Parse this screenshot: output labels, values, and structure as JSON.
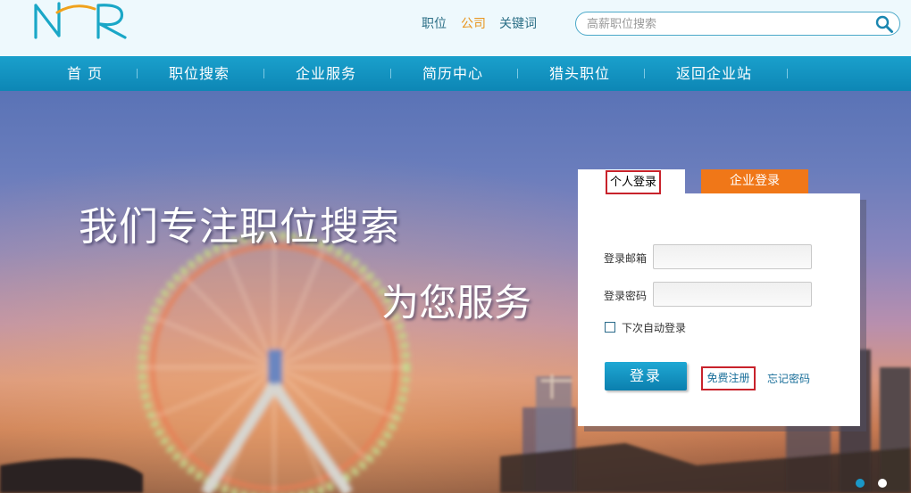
{
  "header": {
    "logo_text": "NHR",
    "search_types": [
      {
        "label": "职位",
        "active": false
      },
      {
        "label": "公司",
        "active": true
      },
      {
        "label": "关键词",
        "active": false
      }
    ],
    "search": {
      "placeholder": "高薪职位搜索",
      "value": "",
      "icon": "search-icon"
    }
  },
  "nav": {
    "items": [
      {
        "label": "首 页"
      },
      {
        "label": "职位搜索"
      },
      {
        "label": "企业服务"
      },
      {
        "label": "简历中心"
      },
      {
        "label": "猎头职位"
      },
      {
        "label": "返回企业站"
      }
    ]
  },
  "hero": {
    "slogan_line1": "我们专注职位搜索",
    "slogan_line2": "为您服务"
  },
  "login": {
    "tab_personal": "个人登录",
    "tab_company": "企业登录",
    "email_label": "登录邮箱",
    "email_value": "",
    "password_label": "登录密码",
    "password_value": "",
    "remember_label": "下次自动登录",
    "remember_checked": false,
    "submit_label": "登录",
    "register_label": "免费注册",
    "forgot_label": "忘记密码"
  },
  "slider": {
    "count": 2,
    "active_index": 0
  },
  "colors": {
    "nav_bg": "#1597c4",
    "accent_orange": "#f07718",
    "active_search_type": "#e8941c",
    "highlight_border": "#c8222b"
  }
}
